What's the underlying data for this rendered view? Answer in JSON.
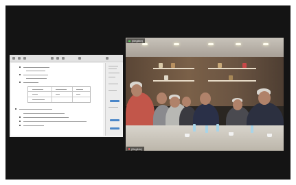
{
  "app": {
    "name": "video-conference"
  },
  "shared_document": {
    "lines_top": [
      "To • (illegible)",
      "• (illegible)",
      "• (illegible)",
      "• (illegible)"
    ],
    "lines_bottom": [
      "• (illegible)",
      "(illegible)",
      "(illegible)",
      "(illegible)",
      "(illegible)"
    ]
  },
  "video": {
    "participant_tag": "(illegible)",
    "speaker_label": "(illegible)"
  },
  "colors": {
    "frame": "#141414",
    "document_bg": "#f4f4f4",
    "accent_button": "#4a86c8",
    "shirt_red": "#c2564a"
  }
}
